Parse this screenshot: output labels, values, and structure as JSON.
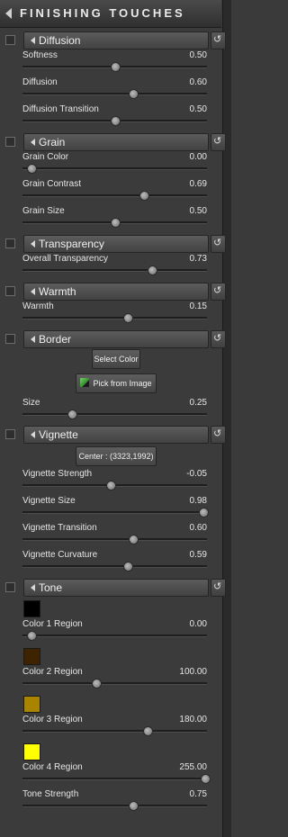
{
  "header": {
    "title": "FINISHING TOUCHES"
  },
  "reset_glyph": "↺",
  "sections": {
    "diffusion": {
      "label": "Diffusion",
      "sliders": [
        {
          "name": "Softness",
          "value": "0.50",
          "pos": 0.5
        },
        {
          "name": "Diffusion",
          "value": "0.60",
          "pos": 0.6
        },
        {
          "name": "Diffusion Transition",
          "value": "0.50",
          "pos": 0.5
        }
      ]
    },
    "grain": {
      "label": "Grain",
      "sliders": [
        {
          "name": "Grain Color",
          "value": "0.00",
          "pos": 0.05
        },
        {
          "name": "Grain Contrast",
          "value": "0.69",
          "pos": 0.66
        },
        {
          "name": "Grain Size",
          "value": "0.50",
          "pos": 0.5
        }
      ]
    },
    "transparency": {
      "label": "Transparency",
      "sliders": [
        {
          "name": "Overall Transparency",
          "value": "0.73",
          "pos": 0.7
        }
      ]
    },
    "warmth": {
      "label": "Warmth",
      "sliders": [
        {
          "name": "Warmth",
          "value": "0.15",
          "pos": 0.57
        }
      ]
    },
    "border": {
      "label": "Border",
      "select_color": "Select Color",
      "pick_from_image": "Pick from Image",
      "sliders": [
        {
          "name": "Size",
          "value": "0.25",
          "pos": 0.27
        }
      ]
    },
    "vignette": {
      "label": "Vignette",
      "center": "Center : (3323,1992)",
      "sliders": [
        {
          "name": "Vignette Strength",
          "value": "-0.05",
          "pos": 0.48
        },
        {
          "name": "Vignette Size",
          "value": "0.98",
          "pos": 0.98
        },
        {
          "name": "Vignette Transition",
          "value": "0.60",
          "pos": 0.6
        },
        {
          "name": "Vignette Curvature",
          "value": "0.59",
          "pos": 0.57
        }
      ]
    },
    "tone": {
      "label": "Tone",
      "regions": [
        {
          "name": "Color 1 Region",
          "value": "0.00",
          "pos": 0.05,
          "color": "#000000"
        },
        {
          "name": "Color 2 Region",
          "value": "100.00",
          "pos": 0.4,
          "color": "#3d2300"
        },
        {
          "name": "Color 3 Region",
          "value": "180.00",
          "pos": 0.68,
          "color": "#a88400"
        },
        {
          "name": "Color 4 Region",
          "value": "255.00",
          "pos": 0.99,
          "color": "#ffff00"
        }
      ],
      "sliders": [
        {
          "name": "Tone Strength",
          "value": "0.75",
          "pos": 0.6
        }
      ]
    }
  }
}
